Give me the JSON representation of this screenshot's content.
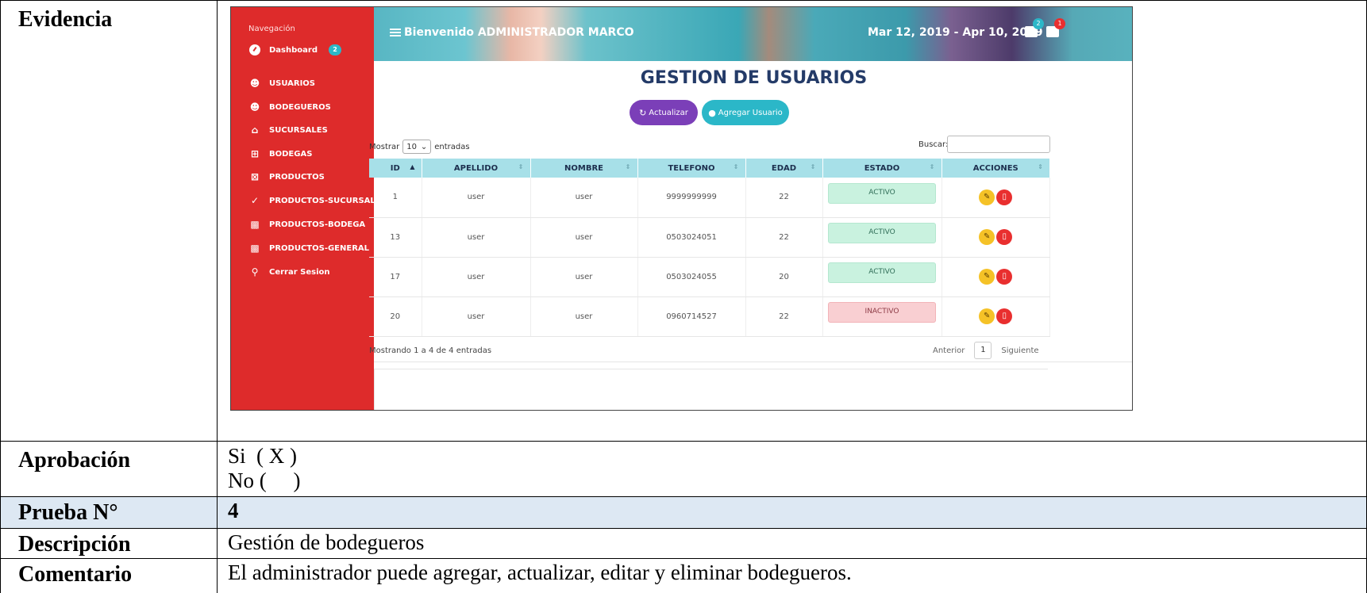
{
  "doc": {
    "evidence_label": "Evidencia",
    "approval_label": "Aprobación",
    "approval_yes": "Si  ( X )",
    "approval_no": "No (     )",
    "test_label": "Prueba N°",
    "test_value": "4",
    "description_label": "Descripción",
    "description_value": "Gestión de bodegueros",
    "comment_label": "Comentario",
    "comment_value": "El administrador puede agregar, actualizar, editar y eliminar bodegueros."
  },
  "app": {
    "sidebar": {
      "title": "Navegación",
      "dashboard": "Dashboard",
      "dashboard_badge": "2",
      "items": [
        {
          "label": "USUARIOS",
          "icon": "users-icon"
        },
        {
          "label": "BODEGUEROS",
          "icon": "users-icon"
        },
        {
          "label": "SUCURSALES",
          "icon": "home-icon"
        },
        {
          "label": "BODEGAS",
          "icon": "grid-icon"
        },
        {
          "label": "PRODUCTOS",
          "icon": "box-icon"
        },
        {
          "label": "PRODUCTOS-SUCURSAL",
          "icon": "check-icon"
        },
        {
          "label": "PRODUCTOS-BODEGA",
          "icon": "factory-icon"
        },
        {
          "label": "PRODUCTOS-GENERAL",
          "icon": "factory-icon"
        }
      ],
      "logout": "Cerrar Sesion"
    },
    "topbar": {
      "welcome": "Bienvenido ADMINISTRADOR MARCO",
      "date_range": "Mar 12, 2019 - Apr 10, 2019",
      "badge1": "2",
      "badge2": "1"
    },
    "title": "GESTION DE USUARIOS",
    "btn_update": "Actualizar",
    "btn_add": "Agregar Usuario",
    "show_label": "Mostrar",
    "show_value": "10",
    "entries_label": "entradas",
    "search_label": "Buscar:",
    "columns": [
      "ID",
      "APELLIDO",
      "NOMBRE",
      "TELEFONO",
      "EDAD",
      "ESTADO",
      "ACCIONES"
    ],
    "rows": [
      {
        "id": "1",
        "apellido": "user",
        "nombre": "user",
        "telefono": "9999999999",
        "edad": "22",
        "estado": "ACTIVO"
      },
      {
        "id": "13",
        "apellido": "user",
        "nombre": "user",
        "telefono": "0503024051",
        "edad": "22",
        "estado": "ACTIVO"
      },
      {
        "id": "17",
        "apellido": "user",
        "nombre": "user",
        "telefono": "0503024055",
        "edad": "20",
        "estado": "ACTIVO"
      },
      {
        "id": "20",
        "apellido": "user",
        "nombre": "user",
        "telefono": "0960714527",
        "edad": "22",
        "estado": "INACTIVO"
      }
    ],
    "footer_info": "Mostrando 1 a 4 de 4 entradas",
    "pager": {
      "prev": "Anterior",
      "current": "1",
      "next": "Siguiente"
    },
    "colors": {
      "sidebar": "#de2b2b",
      "title": "#243b68",
      "update_btn": "#7b3fb8",
      "add_btn": "#2bb7c8",
      "table_header": "#a7e0e8",
      "doc_shade": "#dde8f3"
    }
  }
}
